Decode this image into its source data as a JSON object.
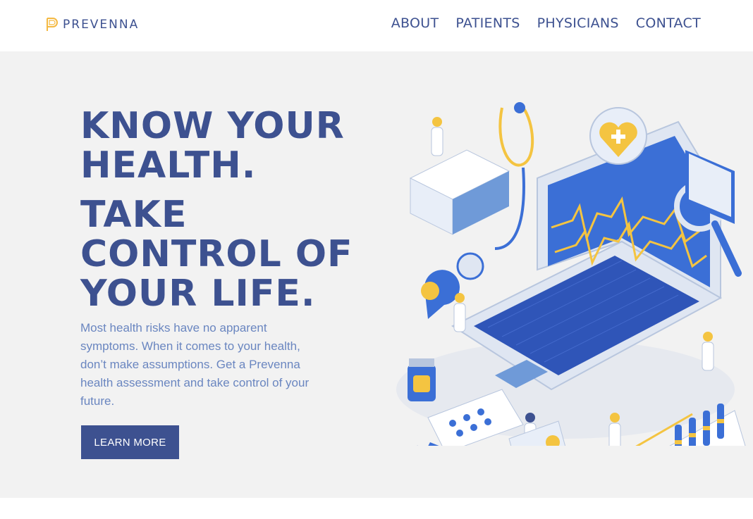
{
  "brand": {
    "name": "PREVENNA"
  },
  "nav": {
    "items": [
      {
        "label": "ABOUT"
      },
      {
        "label": "PATIENTS"
      },
      {
        "label": "PHYSICIANS"
      },
      {
        "label": "CONTACT"
      }
    ]
  },
  "hero": {
    "headline_1_line_1": "KNOW YOUR",
    "headline_1_line_2": "HEALTH.",
    "headline_2_line_1": "TAKE",
    "headline_2_line_2": "CONTROL OF",
    "headline_2_line_3": "YOUR LIFE.",
    "body": "Most health risks have no apparent symptoms. When it comes to your health, don’t make assumptions. Get a Prevenna health assessment and take control of your future.",
    "cta_label": "LEARN MORE"
  },
  "colors": {
    "brand_navy": "#3d5190",
    "body_blue": "#6a86c0",
    "hero_bg": "#f2f2f2",
    "accent_yellow": "#f4c441",
    "screen_blue": "#3b6fd6"
  },
  "icons": [
    "logo-mark-icon",
    "medical-laptop-illustration"
  ]
}
